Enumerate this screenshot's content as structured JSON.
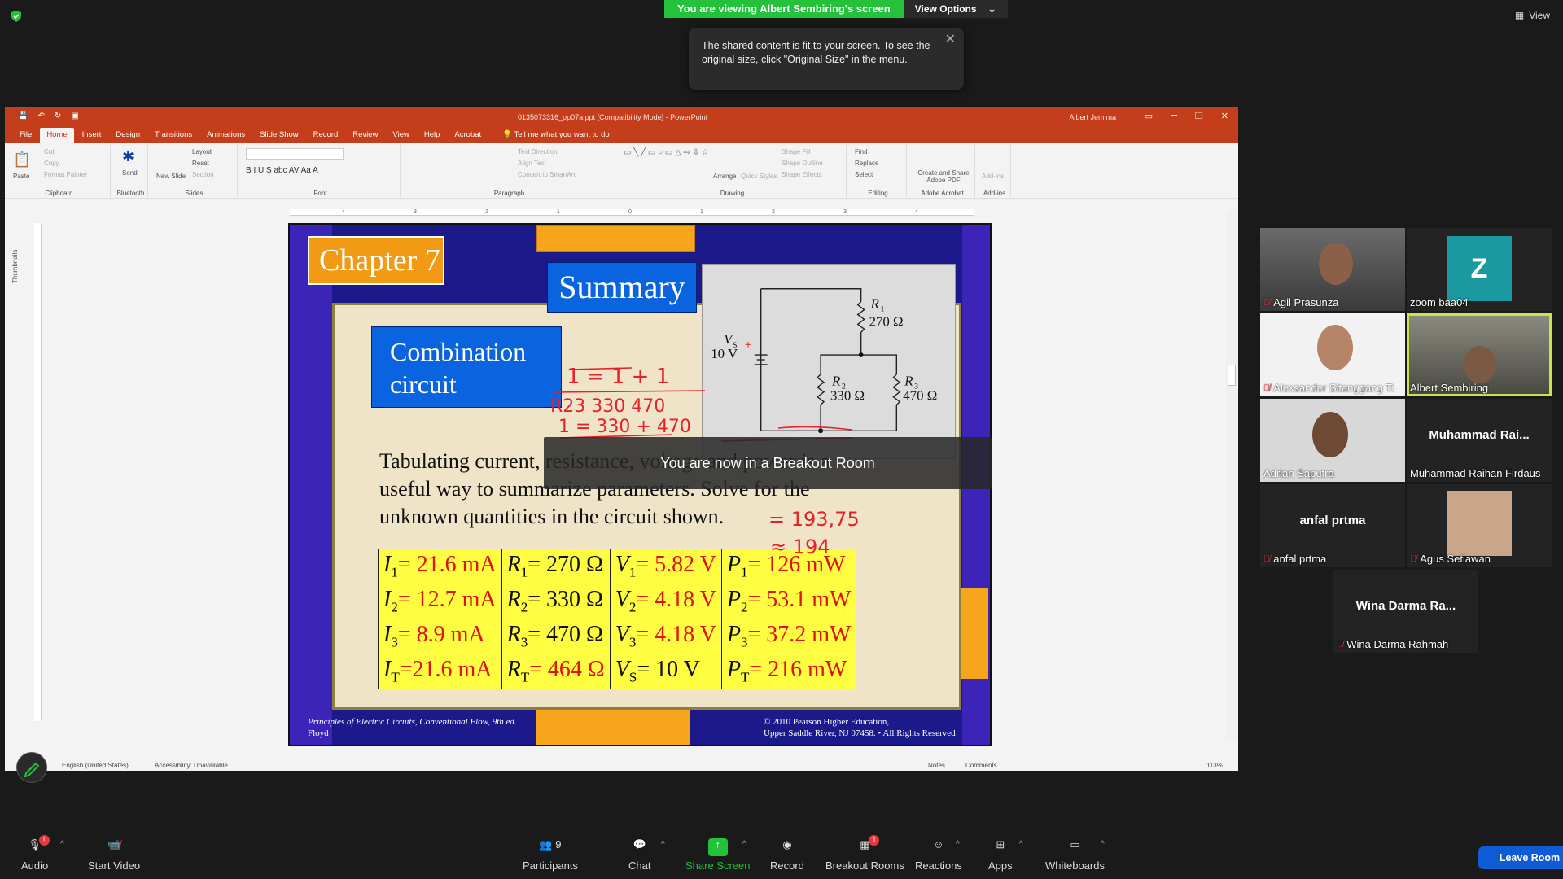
{
  "zoom": {
    "viewing_banner": "You are viewing Albert Sembiring's screen",
    "view_options": "View Options",
    "view_label": "View",
    "tooltip": "The shared content is fit to your screen. To see the original size, click \"Original Size\" in the menu.",
    "breakout_toast": "You are now in a Breakout Room",
    "leave_room": "Leave Room",
    "toolbar": {
      "audio": "Audio",
      "start_video": "Start Video",
      "participants": "Participants",
      "participants_count": "9",
      "chat": "Chat",
      "share_screen": "Share Screen",
      "record": "Record",
      "breakout_rooms": "Breakout Rooms",
      "breakout_badge": "1",
      "reactions": "Reactions",
      "apps": "Apps",
      "whiteboards": "Whiteboards",
      "audio_badge": "!"
    },
    "participants": [
      {
        "name": "Agil Prasunza",
        "muted": true
      },
      {
        "name": "zoom baa04",
        "avatar_letter": "Z",
        "muted": false
      },
      {
        "name": "Alexsander Sitanggang Ti",
        "muted": true
      },
      {
        "name": "Albert Sembiring",
        "muted": false,
        "speaking": true
      },
      {
        "name": "Adrian Saputra",
        "muted": false
      },
      {
        "name": "Muhammad Raihan Firdaus",
        "display": "Muhammad  Rai...",
        "muted": false
      },
      {
        "name": "anfal prtma",
        "display": "anfal prtma",
        "muted": true
      },
      {
        "name": "Agus Setiawan",
        "muted": true
      },
      {
        "name": "Wina Darma Rahmah",
        "display": "Wina Darma Ra...",
        "muted": true
      }
    ],
    "colors": {
      "green": "#23c23a",
      "leave": "#0e5bd6",
      "speaking": "#c8e64a",
      "avatar_teal": "#1a9aa0"
    }
  },
  "powerpoint": {
    "file_title": "0135073316_pp07a.ppt [Compatibility Mode]  -  PowerPoint",
    "user": "Albert Jemima",
    "tabs": [
      "File",
      "Home",
      "Insert",
      "Design",
      "Transitions",
      "Animations",
      "Slide Show",
      "Record",
      "Review",
      "View",
      "Help",
      "Acrobat"
    ],
    "active_tab": "Home",
    "tell_me": "Tell me what you want to do",
    "ribbon": {
      "clipboard": {
        "label": "Clipboard",
        "paste": "Paste",
        "cut": "Cut",
        "copy": "Copy",
        "format_painter": "Format Painter"
      },
      "bluetooth": {
        "label": "Bluetooth",
        "send": "Send"
      },
      "slides": {
        "label": "Slides",
        "new_slide": "New Slide",
        "layout": "Layout",
        "reset": "Reset",
        "section": "Section"
      },
      "font": {
        "label": "Font"
      },
      "paragraph": {
        "label": "Paragraph",
        "text_direction": "Text Direction",
        "align_text": "Align Text",
        "convert": "Convert to SmartArt"
      },
      "drawing": {
        "label": "Drawing",
        "arrange": "Arrange",
        "quick_styles": "Quick Styles",
        "shape_fill": "Shape Fill",
        "shape_outline": "Shape Outline",
        "shape_effects": "Shape Effects"
      },
      "editing": {
        "label": "Editing",
        "find": "Find",
        "replace": "Replace",
        "select": "Select"
      },
      "acrobat": {
        "label": "Adobe Acrobat",
        "create": "Create and Share Adobe PDF"
      },
      "addins": {
        "label": "Add-ins",
        "addins": "Add-ins"
      }
    },
    "thumbnails": "Thumbnails",
    "status": {
      "language": "English (United States)",
      "accessibility": "Accessibility: Unavailable",
      "notes": "Notes",
      "comments": "Comments",
      "zoom": "113%"
    },
    "ruler_ticks": [
      "4",
      "3",
      "2",
      "1",
      "0",
      "1",
      "2",
      "3",
      "4"
    ]
  },
  "slide": {
    "chapter": "Chapter 7",
    "summary": "Summary",
    "combination": "Combination circuit",
    "body": "Tabulating current, resistance, voltage and power is a useful way to summarize parameters.  Solve for the unknown quantities in the circuit shown.",
    "circuit": {
      "vs": "V",
      "vs_sub": "S",
      "vs_value": "10 V",
      "r1": "R",
      "r1_sub": "1",
      "r1_value": "270 Ω",
      "r2": "R",
      "r2_sub": "2",
      "r2_value": "330 Ω",
      "r3": "R",
      "r3_sub": "3",
      "r3_value": "470 Ω",
      "plus": "+"
    },
    "table": [
      [
        {
          "s": "I",
          "sub": "1",
          "v": "= 21.6 mA",
          "c": "red"
        },
        {
          "s": "R",
          "sub": "1",
          "v": "= 270 Ω",
          "c": "blk"
        },
        {
          "s": "V",
          "sub": "1",
          "v": "= 5.82 V",
          "c": "red"
        },
        {
          "s": "P",
          "sub": "1",
          "v": "= 126 mW",
          "c": "red"
        }
      ],
      [
        {
          "s": "I",
          "sub": "2",
          "v": "= 12.7 mA",
          "c": "red"
        },
        {
          "s": "R",
          "sub": "2",
          "v": "= 330 Ω",
          "c": "blk"
        },
        {
          "s": "V",
          "sub": "2",
          "v": "= 4.18 V",
          "c": "red"
        },
        {
          "s": "P",
          "sub": "2",
          "v": "= 53.1 mW",
          "c": "red"
        }
      ],
      [
        {
          "s": "I",
          "sub": "3",
          "v": "=   8.9 mA",
          "c": "red"
        },
        {
          "s": "R",
          "sub": "3",
          "v": "= 470 Ω",
          "c": "blk"
        },
        {
          "s": "V",
          "sub": "3",
          "v": "= 4.18 V",
          "c": "red"
        },
        {
          "s": "P",
          "sub": "3",
          "v": "= 37.2 mW",
          "c": "red"
        }
      ],
      [
        {
          "s": "I",
          "sub": "T",
          "v": "=21.6 mA",
          "c": "red"
        },
        {
          "s": "R",
          "sub": "T",
          "v": "= 464 Ω",
          "c": "red"
        },
        {
          "s": "V",
          "sub": "S",
          "v": "= 10 V",
          "c": "blk"
        },
        {
          "s": "P",
          "sub": "T",
          "v": "=  216 mW",
          "c": "red"
        }
      ]
    ],
    "footer_left_1": "Principles of Electric Circuits, Conventional Flow,  9th ed.",
    "footer_left_2": "Floyd",
    "footer_right_1": "© 2010 Pearson Higher Education,",
    "footer_right_2": "Upper Saddle River, NJ 07458. • All Rights Reserved",
    "ink": {
      "line1": "1    =    1     +    1",
      "line1b": "R23     330      470",
      "line2": "1  =  330 + 470",
      "line3": "= 193,75",
      "line4": "≈ 194",
      "color": "#e8202a"
    }
  }
}
